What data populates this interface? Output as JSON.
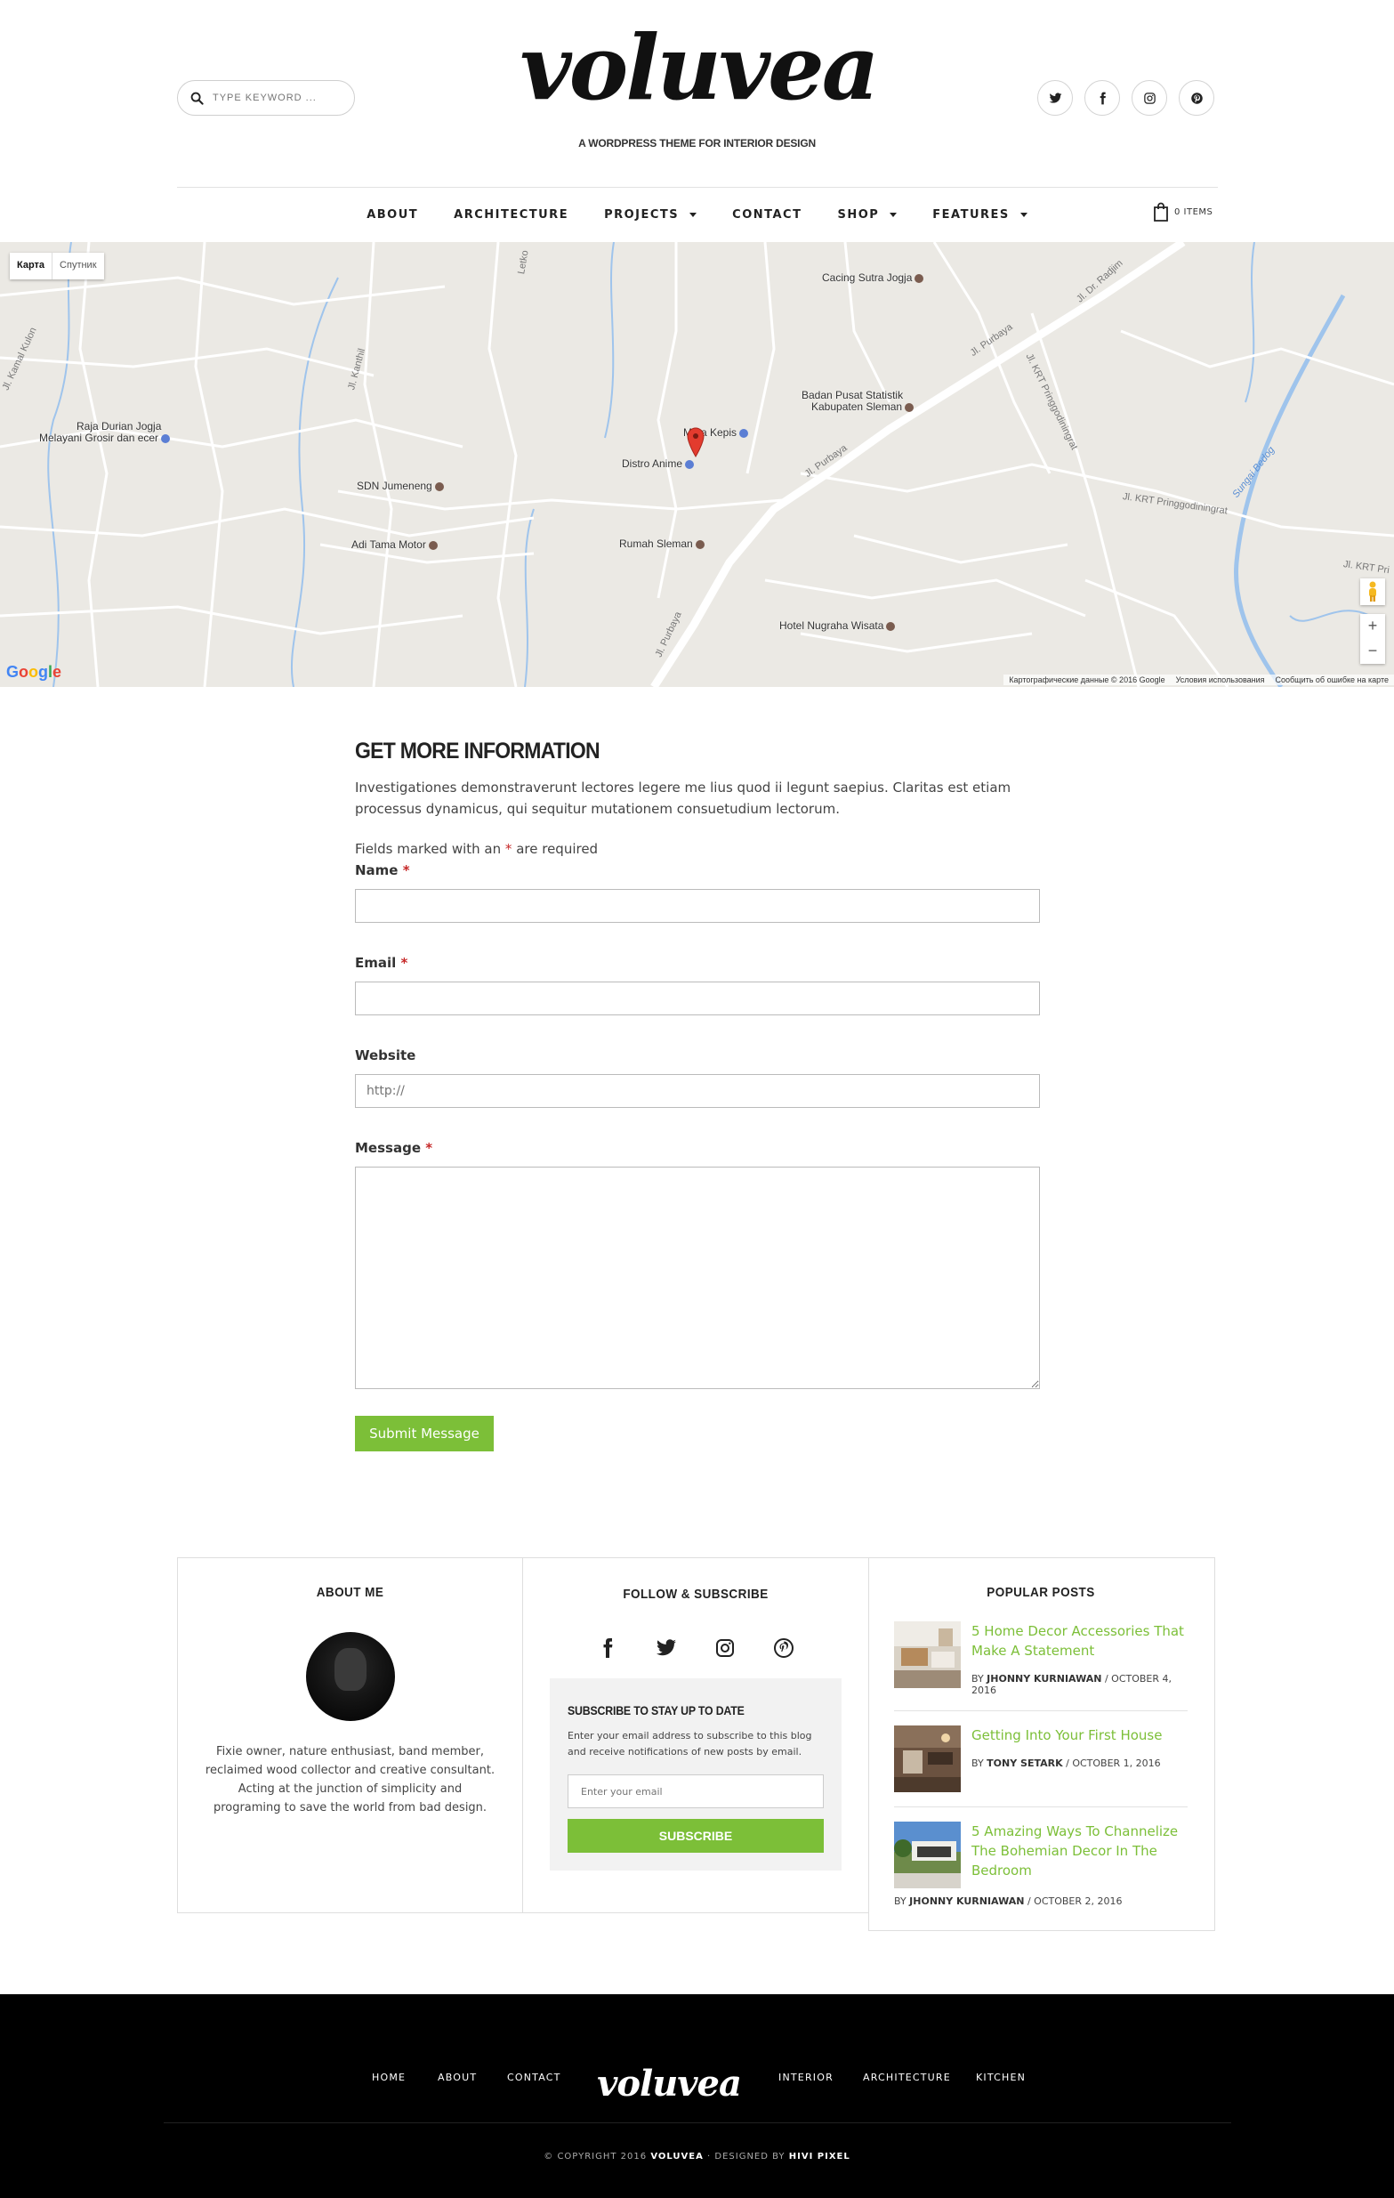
{
  "header": {
    "search_placeholder": "TYPE KEYWORD ...",
    "logo": "voluvea",
    "tagline": "A WORDPRESS THEME FOR INTERIOR DESIGN",
    "cart_label": "0 ITEMS"
  },
  "nav": [
    {
      "label": "ABOUT",
      "dropdown": false
    },
    {
      "label": "ARCHITECTURE",
      "dropdown": false
    },
    {
      "label": "PROJECTS",
      "dropdown": true
    },
    {
      "label": "CONTACT",
      "dropdown": false
    },
    {
      "label": "SHOP",
      "dropdown": true
    },
    {
      "label": "FEATURES",
      "dropdown": true
    }
  ],
  "map": {
    "tab_map": "Карта",
    "tab_satellite": "Спутник",
    "places": [
      "Cacing Sutra Jogja",
      "Badan Pusat Statistik",
      "Kabupaten Sleman",
      "Raja Durian Jogja",
      "Melayani Grosir dan ecer",
      "Mitra Kepis",
      "Distro Anime",
      "SDN Jumeneng",
      "Adi Tama Motor",
      "Rumah Sleman",
      "Hotel Nugraha Wisata"
    ],
    "roads": [
      "Jl. Kamal Kulon",
      "Jl. Kanthil",
      "Letko",
      "Jl. Purbaya",
      "Jl. Purbaya",
      "Jl. Purbaya",
      "Jl. Dr. Radjim",
      "Jl. KRT Pringgodiningrat",
      "Jl. KRT Pringgodiningrat",
      "Jl. KRT Pri",
      "Sungai Bedog"
    ],
    "footer": [
      "Картографические данные © 2016 Google",
      "Условия использования",
      "Сообщить об ошибке на карте"
    ],
    "logo": "Google",
    "zoom_in": "+",
    "zoom_out": "−"
  },
  "form": {
    "title": "GET MORE INFORMATION",
    "description": "Investigationes demonstraverunt lectores legere me lius quod ii legunt saepius. Claritas est etiam processus dynamicus, qui sequitur mutationem consuetudium lectorum.",
    "required_prefix": "Fields marked with an",
    "required_star": "*",
    "required_suffix": "are required",
    "name_label": "Name",
    "email_label": "Email",
    "website_label": "Website",
    "website_placeholder": "http://",
    "message_label": "Message",
    "submit_label": "Submit Message"
  },
  "widgets": {
    "about": {
      "title": "ABOUT ME",
      "text": "Fixie owner, nature enthusiast, band member, reclaimed wood collector and creative consultant. Acting at the junction of simplicity and programing to save the world from bad design."
    },
    "follow": {
      "title": "FOLLOW & SUBSCRIBE",
      "subscribe_title": "SUBSCRIBE TO STAY UP TO DATE",
      "subscribe_desc": "Enter your email address to subscribe to this blog and receive notifications of new posts by email.",
      "email_placeholder": "Enter your email",
      "button": "SUBSCRIBE"
    },
    "popular": {
      "title": "POPULAR POSTS",
      "posts": [
        {
          "title": "5 Home Decor Accessories That Make A Statement",
          "by": "BY",
          "author": "JHONNY KURNIAWAN",
          "date": "OCTOBER 4, 2016"
        },
        {
          "title": "Getting Into Your First House",
          "by": "BY",
          "author": "TONY SETARK",
          "date": "OCTOBER 1, 2016"
        },
        {
          "title": "5 Amazing Ways To Channelize The Bohemian Decor In The Bedroom",
          "by": "BY",
          "author": "JHONNY KURNIAWAN",
          "date": "OCTOBER 2, 2016"
        }
      ]
    }
  },
  "footer": {
    "nav_left": [
      "HOME",
      "ABOUT",
      "CONTACT"
    ],
    "nav_right": [
      "INTERIOR",
      "ARCHITECTURE",
      "KITCHEN"
    ],
    "logo": "voluvea",
    "copyright_prefix": "© COPYRIGHT 2016",
    "copyright_brand": "VOLUVEA",
    "copyright_mid": "· DESIGNED BY",
    "copyright_designer": "HIVI PIXEL"
  },
  "colors": {
    "accent": "#7cbf38",
    "required": "#c62828",
    "footer_bg": "#000000",
    "map_bg": "#ebe9e4"
  }
}
